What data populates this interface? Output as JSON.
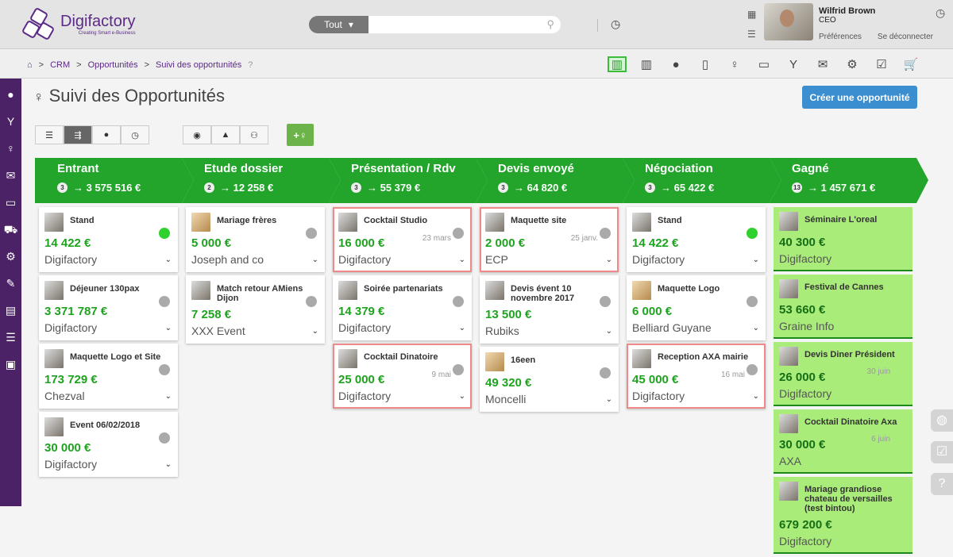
{
  "header": {
    "logo_name": "Digifactory",
    "logo_tagline": "Creating Smart e-Business",
    "search_scope": "Tout",
    "search_placeholder": "",
    "user_name": "Wilfrid Brown",
    "user_role": "CEO",
    "preferences": "Préférences",
    "logout": "Se déconnecter"
  },
  "breadcrumb": [
    "CRM",
    "Opportunités",
    "Suivi des opportunités"
  ],
  "page": {
    "title": "Suivi des Opportunités",
    "create_button": "Créer une opportunité"
  },
  "stages": [
    {
      "name": "Entrant",
      "count": "3",
      "total": "→ 3 575 516 €",
      "cards": [
        {
          "name": "Stand",
          "amount": "14 422 €",
          "company": "Digifactory",
          "status": "green",
          "photo": "m"
        },
        {
          "name": "Déjeuner 130pax",
          "amount": "3 371 787 €",
          "company": "Digifactory",
          "photo": "m"
        },
        {
          "name": "Maquette Logo et Site",
          "amount": "173 729 €",
          "company": "Chezval",
          "photo": "w"
        },
        {
          "name": "Event 06/02/2018",
          "amount": "30 000 €",
          "company": "Digifactory",
          "photo": "m"
        }
      ]
    },
    {
      "name": "Etude dossier",
      "count": "2",
      "total": "→ 12 258 €",
      "cards": [
        {
          "name": "Mariage frères",
          "amount": "5 000 €",
          "company": "Joseph and co",
          "photo": "f"
        },
        {
          "name": "Match retour AMiens Dijon",
          "amount": "7 258 €",
          "company": "XXX Event",
          "photo": "m"
        }
      ]
    },
    {
      "name": "Présentation / Rdv",
      "count": "3",
      "total": "→ 55 379 €",
      "cards": [
        {
          "name": "Cocktail Studio",
          "amount": "16 000 €",
          "company": "Digifactory",
          "date": "23 mars",
          "late": true,
          "photo": "m"
        },
        {
          "name": "Soirée partenariats",
          "amount": "14 379 €",
          "company": "Digifactory",
          "photo": "m"
        },
        {
          "name": "Cocktail Dinatoire",
          "amount": "25 000 €",
          "company": "Digifactory",
          "date": "9 mai",
          "late": true,
          "photo": "m"
        }
      ]
    },
    {
      "name": "Devis envoyé",
      "count": "3",
      "total": "→ 64 820 €",
      "cards": [
        {
          "name": "Maquette site",
          "amount": "2 000 €",
          "company": "ECP",
          "date": "25 janv.",
          "late": true,
          "photo": "w"
        },
        {
          "name": "Devis évent 10 novembre 2017",
          "amount": "13 500 €",
          "company": "Rubiks",
          "photo": "m"
        },
        {
          "name": "16een",
          "amount": "49 320 €",
          "company": "Moncelli",
          "photo": "f"
        }
      ]
    },
    {
      "name": "Négociation",
      "count": "3",
      "total": "→ 65 422 €",
      "cards": [
        {
          "name": "Stand",
          "amount": "14 422 €",
          "company": "Digifactory",
          "status": "green",
          "photo": "m"
        },
        {
          "name": "Maquette Logo",
          "amount": "6 000 €",
          "company": "Belliard Guyane",
          "photo": "f"
        },
        {
          "name": "Reception AXA mairie",
          "amount": "45 000 €",
          "company": "Digifactory",
          "date": "16 mai",
          "late": true,
          "photo": "m"
        }
      ]
    },
    {
      "name": "Gagné",
      "count": "13",
      "total": "→ 1 457 671 €",
      "won": true,
      "cards": [
        {
          "name": "Séminaire L'oreal",
          "amount": "40 300 €",
          "company": "Digifactory",
          "photo": "m"
        },
        {
          "name": "Festival de Cannes",
          "amount": "53 660 €",
          "company": "Graine Info",
          "photo": "w"
        },
        {
          "name": "Devis Diner Président",
          "amount": "26 000 €",
          "company": "Digifactory",
          "date": "30 juin",
          "photo": "m"
        },
        {
          "name": "Cocktail Dinatoire Axa",
          "amount": "30 000 €",
          "company": "AXA",
          "date": "6 juin",
          "photo": "m"
        },
        {
          "name": "Mariage grandiose chateau de versailles (test bintou)",
          "amount": "679 200 €",
          "company": "Digifactory",
          "photo": "m"
        }
      ]
    }
  ],
  "colors": {
    "brand": "#5b2a86",
    "stage": "#22a52a",
    "amount": "#1ea31e",
    "won_bg": "#a9ec7a",
    "create": "#3b8fd1"
  }
}
